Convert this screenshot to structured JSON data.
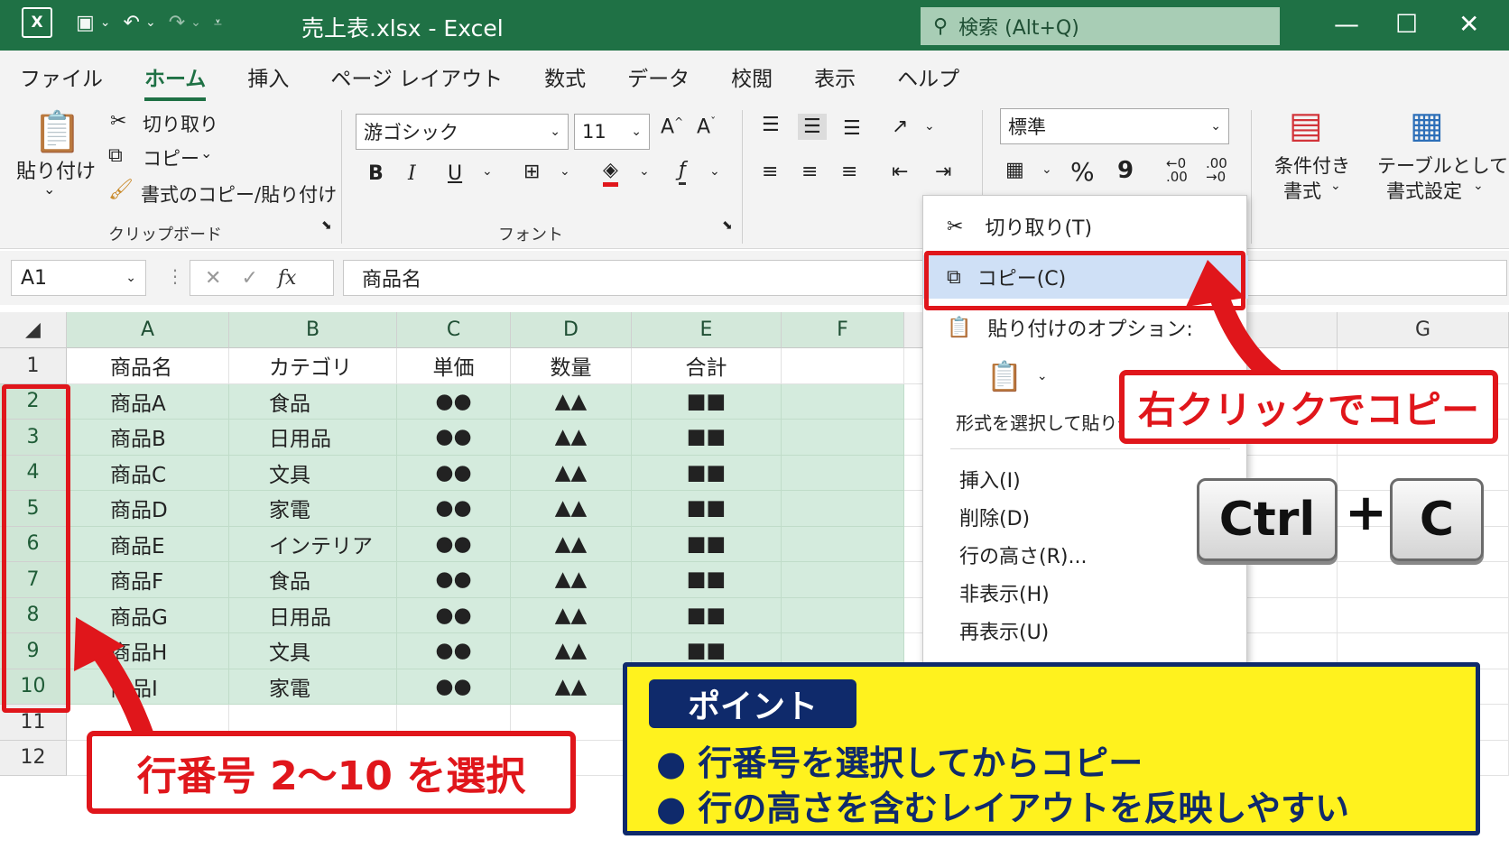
{
  "window": {
    "title": "売上表.xlsx  -  Excel",
    "search_placeholder": "検索 (Alt+Q)",
    "logo": "X"
  },
  "menu": [
    "ファイル",
    "ホーム",
    "挿入",
    "ページ レイアウト",
    "数式",
    "データ",
    "校閲",
    "表示",
    "ヘルプ"
  ],
  "ribbon": {
    "clipboard": {
      "paste": "貼り付け",
      "cut": "切り取り",
      "copy": "コピー",
      "format_painter": "書式のコピー/貼り付け",
      "label": "クリップボード"
    },
    "font": {
      "name": "游ゴシック",
      "size": "11",
      "bold": "B",
      "italic": "I",
      "underline": "U",
      "label": "フォント"
    },
    "number": {
      "format": "標準",
      "percent": "%",
      "comma": "9"
    },
    "styles": {
      "conditional_line1": "条件付き",
      "conditional_line2": "書式",
      "table_line1": "テーブルとして",
      "table_line2": "書式設定"
    }
  },
  "formula_bar": {
    "cell_ref": "A1",
    "fx": "fx",
    "content": "商品名"
  },
  "columns": [
    "A",
    "B",
    "C",
    "D",
    "E",
    "F",
    "G"
  ],
  "rows": [
    {
      "num": "1",
      "cells": [
        "商品名",
        "カテゴリ",
        "単価",
        "数量",
        "合計"
      ]
    },
    {
      "num": "2",
      "cells": [
        "商品A",
        "食品",
        "●●",
        "▲▲",
        "■■"
      ]
    },
    {
      "num": "3",
      "cells": [
        "商品B",
        "日用品",
        "●●",
        "▲▲",
        "■■"
      ]
    },
    {
      "num": "4",
      "cells": [
        "商品C",
        "文具",
        "●●",
        "▲▲",
        "■■"
      ]
    },
    {
      "num": "5",
      "cells": [
        "商品D",
        "家電",
        "●●",
        "▲▲",
        "■■"
      ]
    },
    {
      "num": "6",
      "cells": [
        "商品E",
        "インテリア",
        "●●",
        "▲▲",
        "■■"
      ]
    },
    {
      "num": "7",
      "cells": [
        "商品F",
        "食品",
        "●●",
        "▲▲",
        "■■"
      ]
    },
    {
      "num": "8",
      "cells": [
        "商品G",
        "日用品",
        "●●",
        "▲▲",
        "■■"
      ]
    },
    {
      "num": "9",
      "cells": [
        "商品H",
        "文具",
        "●●",
        "▲▲",
        "■■"
      ]
    },
    {
      "num": "10",
      "cells": [
        "商品I",
        "家電",
        "●●",
        "▲▲",
        "■■"
      ]
    },
    {
      "num": "11",
      "cells": [
        "",
        "",
        "",
        "",
        ""
      ]
    },
    {
      "num": "12",
      "cells": [
        "",
        "",
        "",
        "",
        ""
      ]
    }
  ],
  "context_menu": {
    "cut": "切り取り(T)",
    "copy": "コピー(C)",
    "paste_options": "貼り付けのオプション:",
    "paste_special": "形式を選択して貼り付け(S)...",
    "insert": "挿入(I)",
    "delete": "削除(D)",
    "row_height": "行の高さ(R)...",
    "hide": "非表示(H)",
    "unhide": "再表示(U)"
  },
  "annotations": {
    "right_click": "右クリックでコピー",
    "key_ctrl": "Ctrl",
    "key_plus": "+",
    "key_c": "C",
    "select_rows": "行番号 2〜10 を選択",
    "point_tag": "ポイント",
    "point_1": "● 行番号を選択してからコピー",
    "point_2": "● 行の高さを含むレイアウトを反映しやすい"
  },
  "colors": {
    "excel_green": "#1f7145",
    "callout_red": "#e0161b",
    "point_yellow": "#fff21e",
    "point_navy": "#0f2a6b",
    "selection": "#d4ebdd"
  }
}
